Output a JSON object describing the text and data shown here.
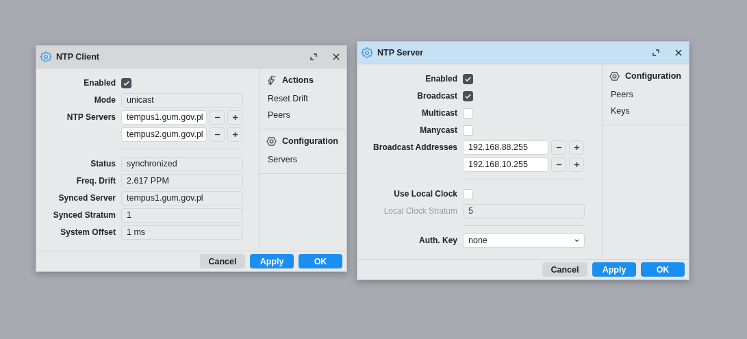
{
  "windows": [
    {
      "title": "NTP Client",
      "active": false,
      "form": [
        {
          "kind": "checkbox",
          "label": "Enabled",
          "checked": true,
          "disabled": false
        },
        {
          "kind": "readonly",
          "label": "Mode",
          "value": "unicast",
          "disabled": false
        },
        {
          "kind": "list",
          "label": "NTP Servers",
          "values": [
            "tempus1.gum.gov.pl",
            "tempus2.gum.gov.pl"
          ],
          "disabled": false
        },
        {
          "kind": "separator"
        },
        {
          "kind": "readonly",
          "label": "Status",
          "value": "synchronized",
          "disabled": false
        },
        {
          "kind": "readonly",
          "label": "Freq. Drift",
          "value": "2.617 PPM",
          "disabled": false
        },
        {
          "kind": "readonly",
          "label": "Synced Server",
          "value": "tempus1.gum.gov.pl",
          "disabled": false
        },
        {
          "kind": "readonly",
          "label": "Synced Stratum",
          "value": "1",
          "disabled": false
        },
        {
          "kind": "readonly",
          "label": "System Offset",
          "value": "1 ms",
          "disabled": false
        }
      ],
      "sidebar": [
        {
          "kind": "actions",
          "title": "Actions",
          "items": [
            "Reset Drift",
            "Peers"
          ]
        },
        {
          "kind": "configuration",
          "title": "Configuration",
          "items": [
            "Servers"
          ]
        }
      ],
      "buttons": [
        {
          "label": "Cancel",
          "kind": "secondary"
        },
        {
          "label": "Apply",
          "kind": "primary"
        },
        {
          "label": "OK",
          "kind": "primary"
        }
      ]
    },
    {
      "title": "NTP Server",
      "active": true,
      "form": [
        {
          "kind": "checkbox",
          "label": "Enabled",
          "checked": true,
          "disabled": false
        },
        {
          "kind": "checkbox",
          "label": "Broadcast",
          "checked": true,
          "disabled": false
        },
        {
          "kind": "checkbox",
          "label": "Multicast",
          "checked": false,
          "disabled": false
        },
        {
          "kind": "checkbox",
          "label": "Manycast",
          "checked": false,
          "disabled": false
        },
        {
          "kind": "list",
          "label": "Broadcast Addresses",
          "values": [
            "192.168.88.255",
            "192.168.10.255"
          ],
          "disabled": false
        },
        {
          "kind": "separator"
        },
        {
          "kind": "checkbox",
          "label": "Use Local Clock",
          "checked": false,
          "disabled": false
        },
        {
          "kind": "readonly",
          "label": "Local Clock Stratum",
          "value": "5",
          "disabled": true
        },
        {
          "kind": "separator"
        },
        {
          "kind": "select",
          "label": "Auth. Key",
          "value": "none",
          "disabled": false
        }
      ],
      "sidebar": [
        {
          "kind": "configuration",
          "title": "Configuration",
          "items": [
            "Peers",
            "Keys"
          ]
        }
      ],
      "buttons": [
        {
          "label": "Cancel",
          "kind": "secondary"
        },
        {
          "label": "Apply",
          "kind": "primary"
        },
        {
          "label": "OK",
          "kind": "primary"
        }
      ]
    }
  ]
}
